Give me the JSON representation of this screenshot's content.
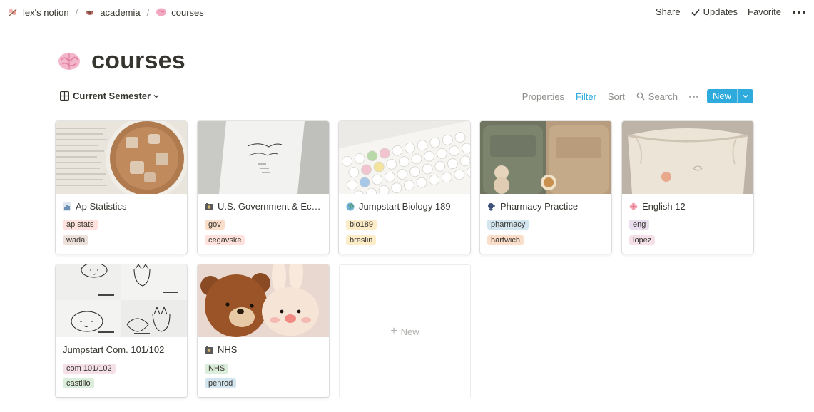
{
  "breadcrumb": [
    {
      "label": "lex's notion",
      "icon": "cherry-blossom-icon"
    },
    {
      "label": "academia",
      "icon": "bug-icon"
    },
    {
      "label": "courses",
      "icon": "brain-icon"
    }
  ],
  "top_actions": {
    "share": "Share",
    "updates": "Updates",
    "favorite": "Favorite"
  },
  "page": {
    "title": "courses",
    "icon": "brain-icon"
  },
  "view": {
    "name": "Current Semester",
    "properties": "Properties",
    "filter": "Filter",
    "sort": "Sort",
    "search": "Search",
    "new": "New"
  },
  "cards": [
    {
      "title": "Ap Statistics",
      "icon": "chart-icon",
      "cover": "iced-coffee-on-book",
      "tags": [
        {
          "label": "ap stats",
          "color": "#ffe2dd"
        },
        {
          "label": "wada",
          "color": "#eee0da"
        }
      ]
    },
    {
      "title": "U.S. Government & Eco…",
      "icon": "photo-icon",
      "cover": "white-tote-bag",
      "tags": [
        {
          "label": "gov",
          "color": "#fadec9"
        },
        {
          "label": "cegavske",
          "color": "#ffe2dd"
        }
      ]
    },
    {
      "title": "Jumpstart Biology 189",
      "icon": "globe-icon",
      "cover": "pastel-keyboard",
      "tags": [
        {
          "label": "bio189",
          "color": "#fdecc8"
        },
        {
          "label": "breslin",
          "color": "#fdecc8"
        }
      ]
    },
    {
      "title": "Pharmacy Practice",
      "icon": "speaking-head-icon",
      "cover": "backpacks-with-bears",
      "tags": [
        {
          "label": "pharmacy",
          "color": "#d3e5ef"
        },
        {
          "label": "hartwich",
          "color": "#fadec9"
        }
      ]
    },
    {
      "title": "English 12",
      "icon": "flower-icon",
      "cover": "drawstring-bag",
      "tags": [
        {
          "label": "eng",
          "color": "#e8deee"
        },
        {
          "label": "lopez",
          "color": "#f5e0e9"
        }
      ]
    },
    {
      "title": "Jumpstart Com. 101/102",
      "icon": "",
      "cover": "doodle-bags",
      "tags": [
        {
          "label": "com 101/102",
          "color": "#f5e0e9"
        },
        {
          "label": "castillo",
          "color": "#dbeddb"
        }
      ]
    },
    {
      "title": "NHS",
      "icon": "photo-icon",
      "cover": "plush-bear-and-bunny",
      "tags": [
        {
          "label": "NHS",
          "color": "#dbeddb"
        },
        {
          "label": "penrod",
          "color": "#d3e5ef"
        }
      ]
    }
  ],
  "new_card": {
    "label": "New",
    "icon": "plus-icon"
  }
}
